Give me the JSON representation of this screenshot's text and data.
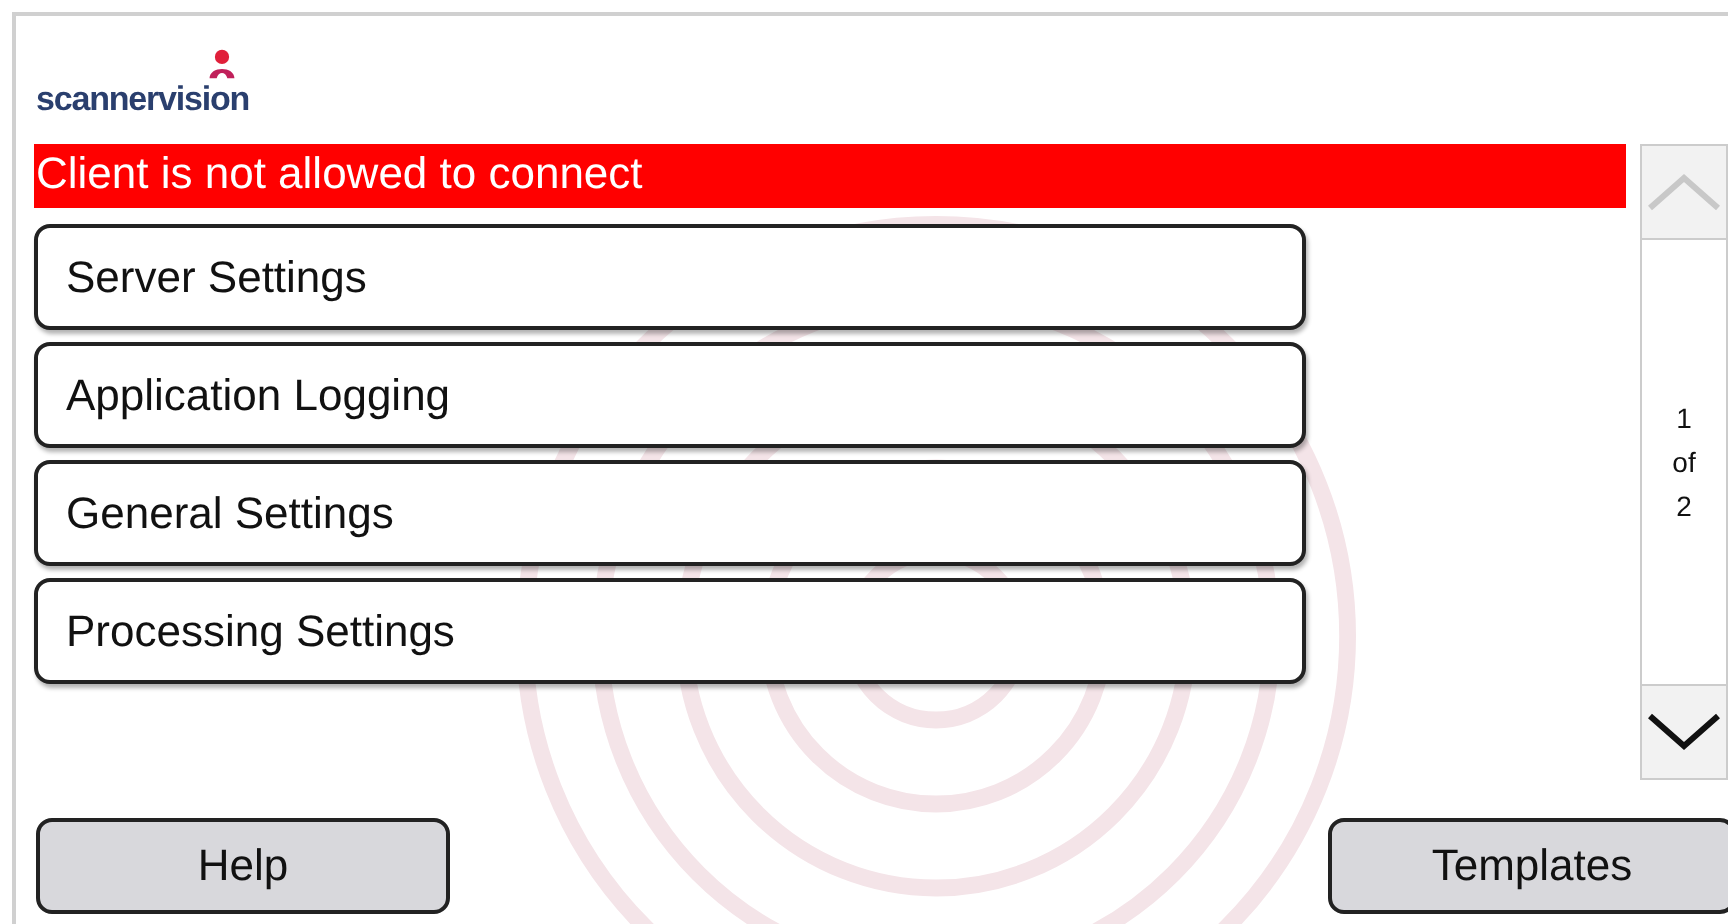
{
  "logo": {
    "text": "scannervision"
  },
  "error_banner": "Client is not allowed to connect",
  "menu": [
    {
      "label": "Server Settings"
    },
    {
      "label": "Application Logging"
    },
    {
      "label": "General Settings"
    },
    {
      "label": "Processing Settings"
    }
  ],
  "pager": {
    "current": "1",
    "of": "of",
    "total": "2",
    "up_disabled": true,
    "down_disabled": false
  },
  "buttons": [
    {
      "label": "Help"
    },
    {
      "label": "Templates"
    }
  ]
}
